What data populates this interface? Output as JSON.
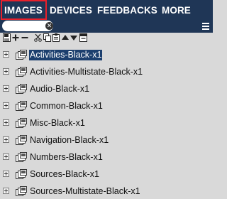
{
  "nav": {
    "tabs": [
      {
        "label": "IMAGES",
        "active": true
      },
      {
        "label": "DEVICES",
        "active": false
      },
      {
        "label": "FEEDBACKS",
        "active": false
      },
      {
        "label": "MORE",
        "active": false
      }
    ]
  },
  "search": {
    "value": "",
    "placeholder": "",
    "clear_icon": "close-circle-icon",
    "menu_icon": "hamburger-menu-icon"
  },
  "toolbar": {
    "buttons": [
      "save-icon",
      "add-icon",
      "remove-icon",
      "cut-icon",
      "copy-icon",
      "paste-icon",
      "move-up-icon",
      "move-down-icon",
      "collapse-icon"
    ]
  },
  "tree": {
    "items": [
      {
        "label": "Activities-Black-x1",
        "selected": true
      },
      {
        "label": "Activities-Multistate-Black-x1",
        "selected": false
      },
      {
        "label": "Audio-Black-x1",
        "selected": false
      },
      {
        "label": "Common-Black-x1",
        "selected": false
      },
      {
        "label": "Misc-Black-x1",
        "selected": false
      },
      {
        "label": "Navigation-Black-x1",
        "selected": false
      },
      {
        "label": "Numbers-Black-x1",
        "selected": false
      },
      {
        "label": "Sources-Black-x1",
        "selected": false
      },
      {
        "label": "Sources-Multistate-Black-x1",
        "selected": false
      }
    ]
  },
  "colors": {
    "nav_bg": "#1f3656",
    "active_tab_border": "#e8202b",
    "selection_bg": "#1c3f6e",
    "panel_bg": "#d9d9d9"
  }
}
